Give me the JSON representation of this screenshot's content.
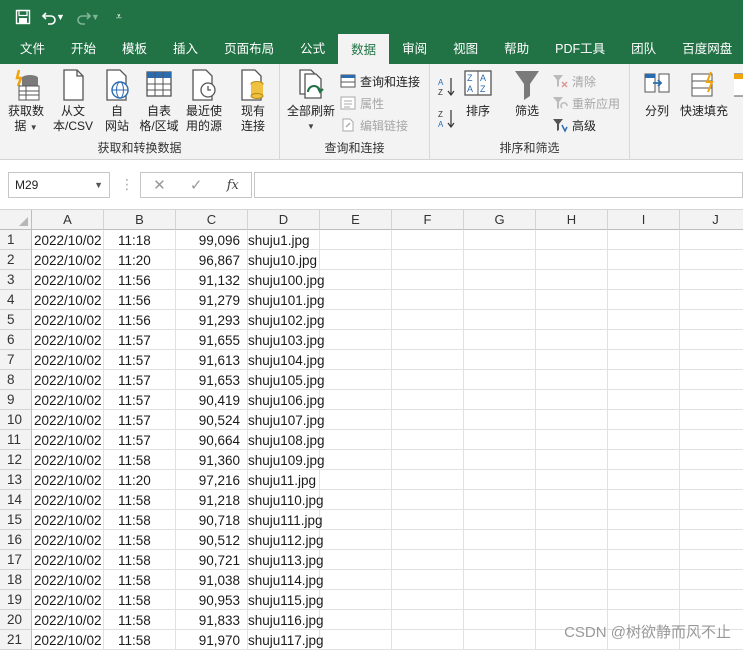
{
  "qat": {
    "save_icon": "save-icon",
    "undo_icon": "undo-icon",
    "redo_icon": "redo-icon",
    "customize_icon": "customize-qat-icon"
  },
  "tabs": [
    "文件",
    "开始",
    "模板",
    "插入",
    "页面布局",
    "公式",
    "数据",
    "审阅",
    "视图",
    "帮助",
    "PDF工具",
    "团队",
    "百度网盘"
  ],
  "active_tab": "数据",
  "ribbon": {
    "get_transform": {
      "label": "获取和转换数据",
      "get_data": [
        "获取数",
        "据"
      ],
      "from_text": [
        "从文",
        "本/CSV"
      ],
      "from_web": [
        "自",
        "网站"
      ],
      "from_table": [
        "自表",
        "格/区域"
      ],
      "recent_sources": [
        "最近使",
        "用的源"
      ],
      "existing_conn": [
        "现有",
        "连接"
      ]
    },
    "queries": {
      "label": "查询和连接",
      "refresh_all": [
        "全部刷新"
      ],
      "queries_connections": "查询和连接",
      "properties": "属性",
      "edit_links": "编辑链接"
    },
    "sort_filter": {
      "label": "排序和筛选",
      "sort": "排序",
      "filter": "筛选",
      "clear": "清除",
      "reapply": "重新应用",
      "advanced": "高级"
    },
    "data_tools": {
      "text_to_columns": "分列",
      "flash_fill": "快速填充"
    }
  },
  "formula_bar": {
    "name_box": "M29",
    "cancel_icon": "cancel-icon",
    "enter_icon": "enter-icon",
    "fx_label": "fx",
    "formula": ""
  },
  "grid": {
    "columns": [
      "A",
      "B",
      "C",
      "D",
      "E",
      "F",
      "G",
      "H",
      "I",
      "J"
    ],
    "rows": [
      {
        "num": "1",
        "a": "2022/10/02",
        "b": "11:18",
        "c": "99,096",
        "d": "shuju1.jpg"
      },
      {
        "num": "2",
        "a": "2022/10/02",
        "b": "11:20",
        "c": "96,867",
        "d": "shuju10.jpg"
      },
      {
        "num": "3",
        "a": "2022/10/02",
        "b": "11:56",
        "c": "91,132",
        "d": "shuju100.jpg"
      },
      {
        "num": "4",
        "a": "2022/10/02",
        "b": "11:56",
        "c": "91,279",
        "d": "shuju101.jpg"
      },
      {
        "num": "5",
        "a": "2022/10/02",
        "b": "11:56",
        "c": "91,293",
        "d": "shuju102.jpg"
      },
      {
        "num": "6",
        "a": "2022/10/02",
        "b": "11:57",
        "c": "91,655",
        "d": "shuju103.jpg"
      },
      {
        "num": "7",
        "a": "2022/10/02",
        "b": "11:57",
        "c": "91,613",
        "d": "shuju104.jpg"
      },
      {
        "num": "8",
        "a": "2022/10/02",
        "b": "11:57",
        "c": "91,653",
        "d": "shuju105.jpg"
      },
      {
        "num": "9",
        "a": "2022/10/02",
        "b": "11:57",
        "c": "90,419",
        "d": "shuju106.jpg"
      },
      {
        "num": "10",
        "a": "2022/10/02",
        "b": "11:57",
        "c": "90,524",
        "d": "shuju107.jpg"
      },
      {
        "num": "11",
        "a": "2022/10/02",
        "b": "11:57",
        "c": "90,664",
        "d": "shuju108.jpg"
      },
      {
        "num": "12",
        "a": "2022/10/02",
        "b": "11:58",
        "c": "91,360",
        "d": "shuju109.jpg"
      },
      {
        "num": "13",
        "a": "2022/10/02",
        "b": "11:20",
        "c": "97,216",
        "d": "shuju11.jpg"
      },
      {
        "num": "14",
        "a": "2022/10/02",
        "b": "11:58",
        "c": "91,218",
        "d": "shuju110.jpg"
      },
      {
        "num": "15",
        "a": "2022/10/02",
        "b": "11:58",
        "c": "90,718",
        "d": "shuju111.jpg"
      },
      {
        "num": "16",
        "a": "2022/10/02",
        "b": "11:58",
        "c": "90,512",
        "d": "shuju112.jpg"
      },
      {
        "num": "17",
        "a": "2022/10/02",
        "b": "11:58",
        "c": "90,721",
        "d": "shuju113.jpg"
      },
      {
        "num": "18",
        "a": "2022/10/02",
        "b": "11:58",
        "c": "91,038",
        "d": "shuju114.jpg"
      },
      {
        "num": "19",
        "a": "2022/10/02",
        "b": "11:58",
        "c": "90,953",
        "d": "shuju115.jpg"
      },
      {
        "num": "20",
        "a": "2022/10/02",
        "b": "11:58",
        "c": "91,833",
        "d": "shuju116.jpg"
      },
      {
        "num": "21",
        "a": "2022/10/02",
        "b": "11:58",
        "c": "91,970",
        "d": "shuju117.jpg"
      }
    ]
  },
  "watermark": "CSDN @树欲静而风不止"
}
